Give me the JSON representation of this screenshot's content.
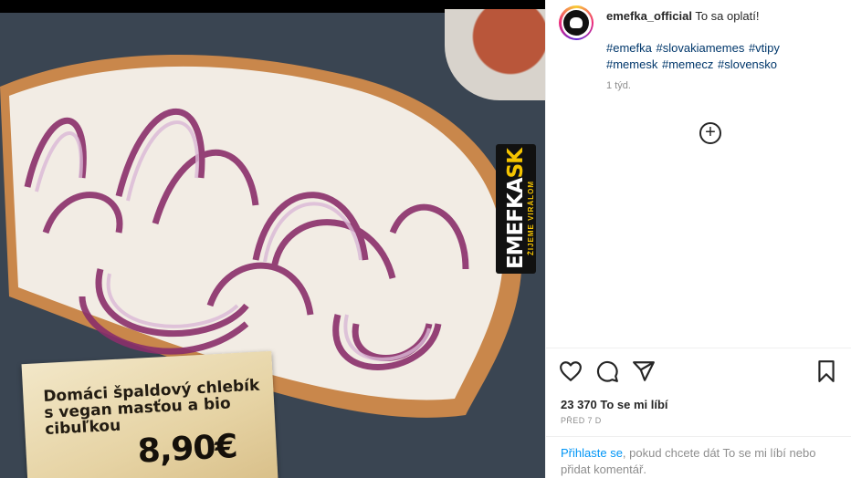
{
  "post": {
    "username": "emefka_official",
    "caption": "To sa oplatí!",
    "hashtags": [
      "#emefka",
      "#slovakiamemes",
      "#vtipy",
      "#memesk",
      "#memecz",
      "#slovensko"
    ],
    "time_ago": "1 týd.",
    "likes": "23 370 To se mi líbí",
    "date": "PŘED 7 D"
  },
  "image": {
    "price_text": "Domáci špaldový chlebík s vegan masťou a bio cibuľkou",
    "price_value": "8,90€",
    "watermark_main": "EMEFKA",
    "watermark_sk": "SK",
    "watermark_sub": "ŽIJEME VIRÁLOM"
  },
  "comments": {
    "more_icon": "plus-circle-icon"
  },
  "actions": {
    "like_icon": "heart-icon",
    "comment_icon": "comment-icon",
    "share_icon": "send-icon",
    "save_icon": "bookmark-icon"
  },
  "login": {
    "link": "Přihlaste se",
    "text": ", pokud chcete dát To se mi líbí nebo přidat komentář."
  },
  "colors": {
    "link": "#00376b",
    "login_link": "#0095f6",
    "muted": "#8e8e8e"
  }
}
